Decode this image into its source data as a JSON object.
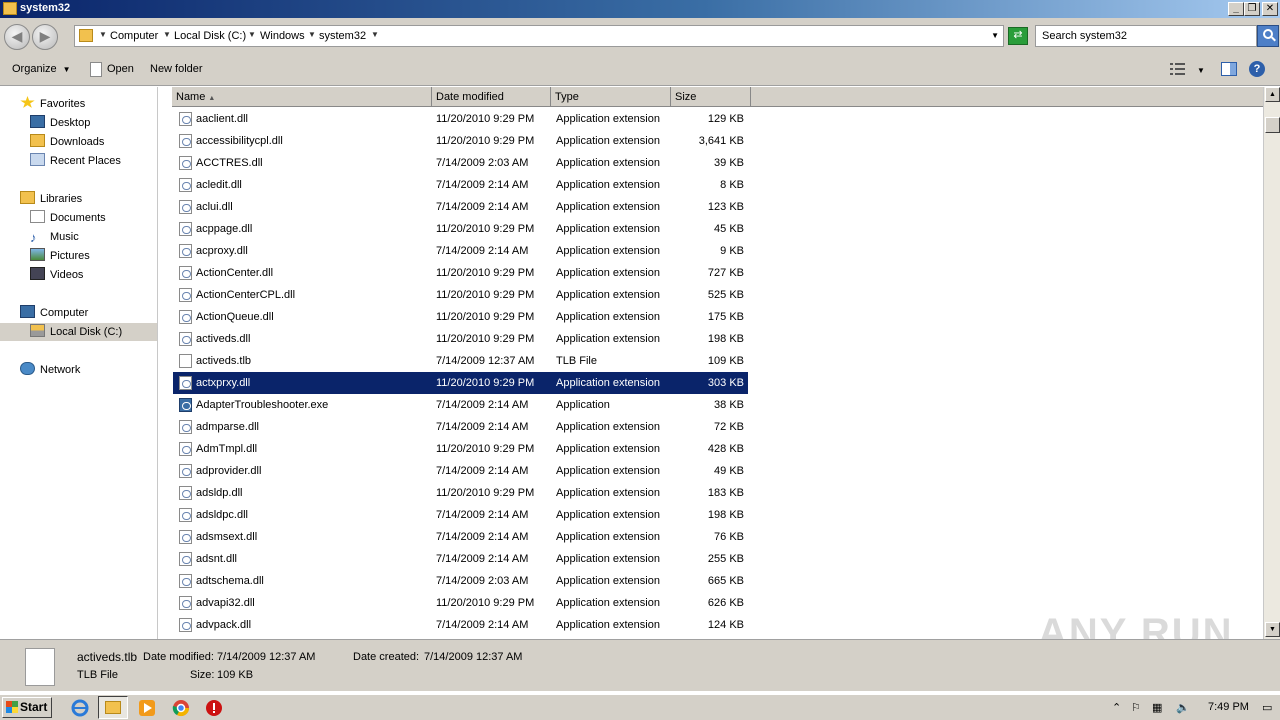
{
  "window": {
    "title": "system32"
  },
  "address": {
    "crumbs": [
      "Computer",
      "Local Disk (C:)",
      "Windows",
      "system32"
    ]
  },
  "search": {
    "placeholder": "Search system32"
  },
  "toolbar": {
    "organize": "Organize",
    "open": "Open",
    "new_folder": "New folder"
  },
  "nav": {
    "favorites": "Favorites",
    "desktop": "Desktop",
    "downloads": "Downloads",
    "recent": "Recent Places",
    "libraries": "Libraries",
    "documents": "Documents",
    "music": "Music",
    "pictures": "Pictures",
    "videos": "Videos",
    "computer": "Computer",
    "local_disk": "Local Disk (C:)",
    "network": "Network"
  },
  "columns": {
    "name": "Name",
    "date": "Date modified",
    "type": "Type",
    "size": "Size"
  },
  "files": [
    {
      "name": "aaclient.dll",
      "date": "11/20/2010 9:29 PM",
      "type": "Application extension",
      "size": "129 KB"
    },
    {
      "name": "accessibilitycpl.dll",
      "date": "11/20/2010 9:29 PM",
      "type": "Application extension",
      "size": "3,641 KB"
    },
    {
      "name": "ACCTRES.dll",
      "date": "7/14/2009 2:03 AM",
      "type": "Application extension",
      "size": "39 KB"
    },
    {
      "name": "acledit.dll",
      "date": "7/14/2009 2:14 AM",
      "type": "Application extension",
      "size": "8 KB"
    },
    {
      "name": "aclui.dll",
      "date": "7/14/2009 2:14 AM",
      "type": "Application extension",
      "size": "123 KB"
    },
    {
      "name": "acppage.dll",
      "date": "11/20/2010 9:29 PM",
      "type": "Application extension",
      "size": "45 KB"
    },
    {
      "name": "acproxy.dll",
      "date": "7/14/2009 2:14 AM",
      "type": "Application extension",
      "size": "9 KB"
    },
    {
      "name": "ActionCenter.dll",
      "date": "11/20/2010 9:29 PM",
      "type": "Application extension",
      "size": "727 KB"
    },
    {
      "name": "ActionCenterCPL.dll",
      "date": "11/20/2010 9:29 PM",
      "type": "Application extension",
      "size": "525 KB"
    },
    {
      "name": "ActionQueue.dll",
      "date": "11/20/2010 9:29 PM",
      "type": "Application extension",
      "size": "175 KB"
    },
    {
      "name": "activeds.dll",
      "date": "11/20/2010 9:29 PM",
      "type": "Application extension",
      "size": "198 KB"
    },
    {
      "name": "activeds.tlb",
      "date": "7/14/2009 12:37 AM",
      "type": "TLB File",
      "size": "109 KB"
    },
    {
      "name": "actxprxy.dll",
      "date": "11/20/2010 9:29 PM",
      "type": "Application extension",
      "size": "303 KB"
    },
    {
      "name": "AdapterTroubleshooter.exe",
      "date": "7/14/2009 2:14 AM",
      "type": "Application",
      "size": "38 KB"
    },
    {
      "name": "admparse.dll",
      "date": "7/14/2009 2:14 AM",
      "type": "Application extension",
      "size": "72 KB"
    },
    {
      "name": "AdmTmpl.dll",
      "date": "11/20/2010 9:29 PM",
      "type": "Application extension",
      "size": "428 KB"
    },
    {
      "name": "adprovider.dll",
      "date": "7/14/2009 2:14 AM",
      "type": "Application extension",
      "size": "49 KB"
    },
    {
      "name": "adsldp.dll",
      "date": "11/20/2010 9:29 PM",
      "type": "Application extension",
      "size": "183 KB"
    },
    {
      "name": "adsldpc.dll",
      "date": "7/14/2009 2:14 AM",
      "type": "Application extension",
      "size": "198 KB"
    },
    {
      "name": "adsmsext.dll",
      "date": "7/14/2009 2:14 AM",
      "type": "Application extension",
      "size": "76 KB"
    },
    {
      "name": "adsnt.dll",
      "date": "7/14/2009 2:14 AM",
      "type": "Application extension",
      "size": "255 KB"
    },
    {
      "name": "adtschema.dll",
      "date": "7/14/2009 2:03 AM",
      "type": "Application extension",
      "size": "665 KB"
    },
    {
      "name": "advapi32.dll",
      "date": "11/20/2010 9:29 PM",
      "type": "Application extension",
      "size": "626 KB"
    },
    {
      "name": "advpack.dll",
      "date": "7/14/2009 2:14 AM",
      "type": "Application extension",
      "size": "124 KB"
    }
  ],
  "selected_index": 12,
  "details": {
    "name": "activeds.tlb",
    "type": "TLB File",
    "modified_label": "Date modified:",
    "modified_value": "7/14/2009 12:37 AM",
    "created_label": "Date created:",
    "created_value": "7/14/2009 12:37 AM",
    "size_label": "Size:",
    "size_value": "109 KB"
  },
  "watermark": "ANY RUN",
  "taskbar": {
    "start": "Start",
    "clock": "7:49 PM"
  },
  "colors": {
    "selection": "#0a246a",
    "chrome": "#d4d0c8"
  }
}
